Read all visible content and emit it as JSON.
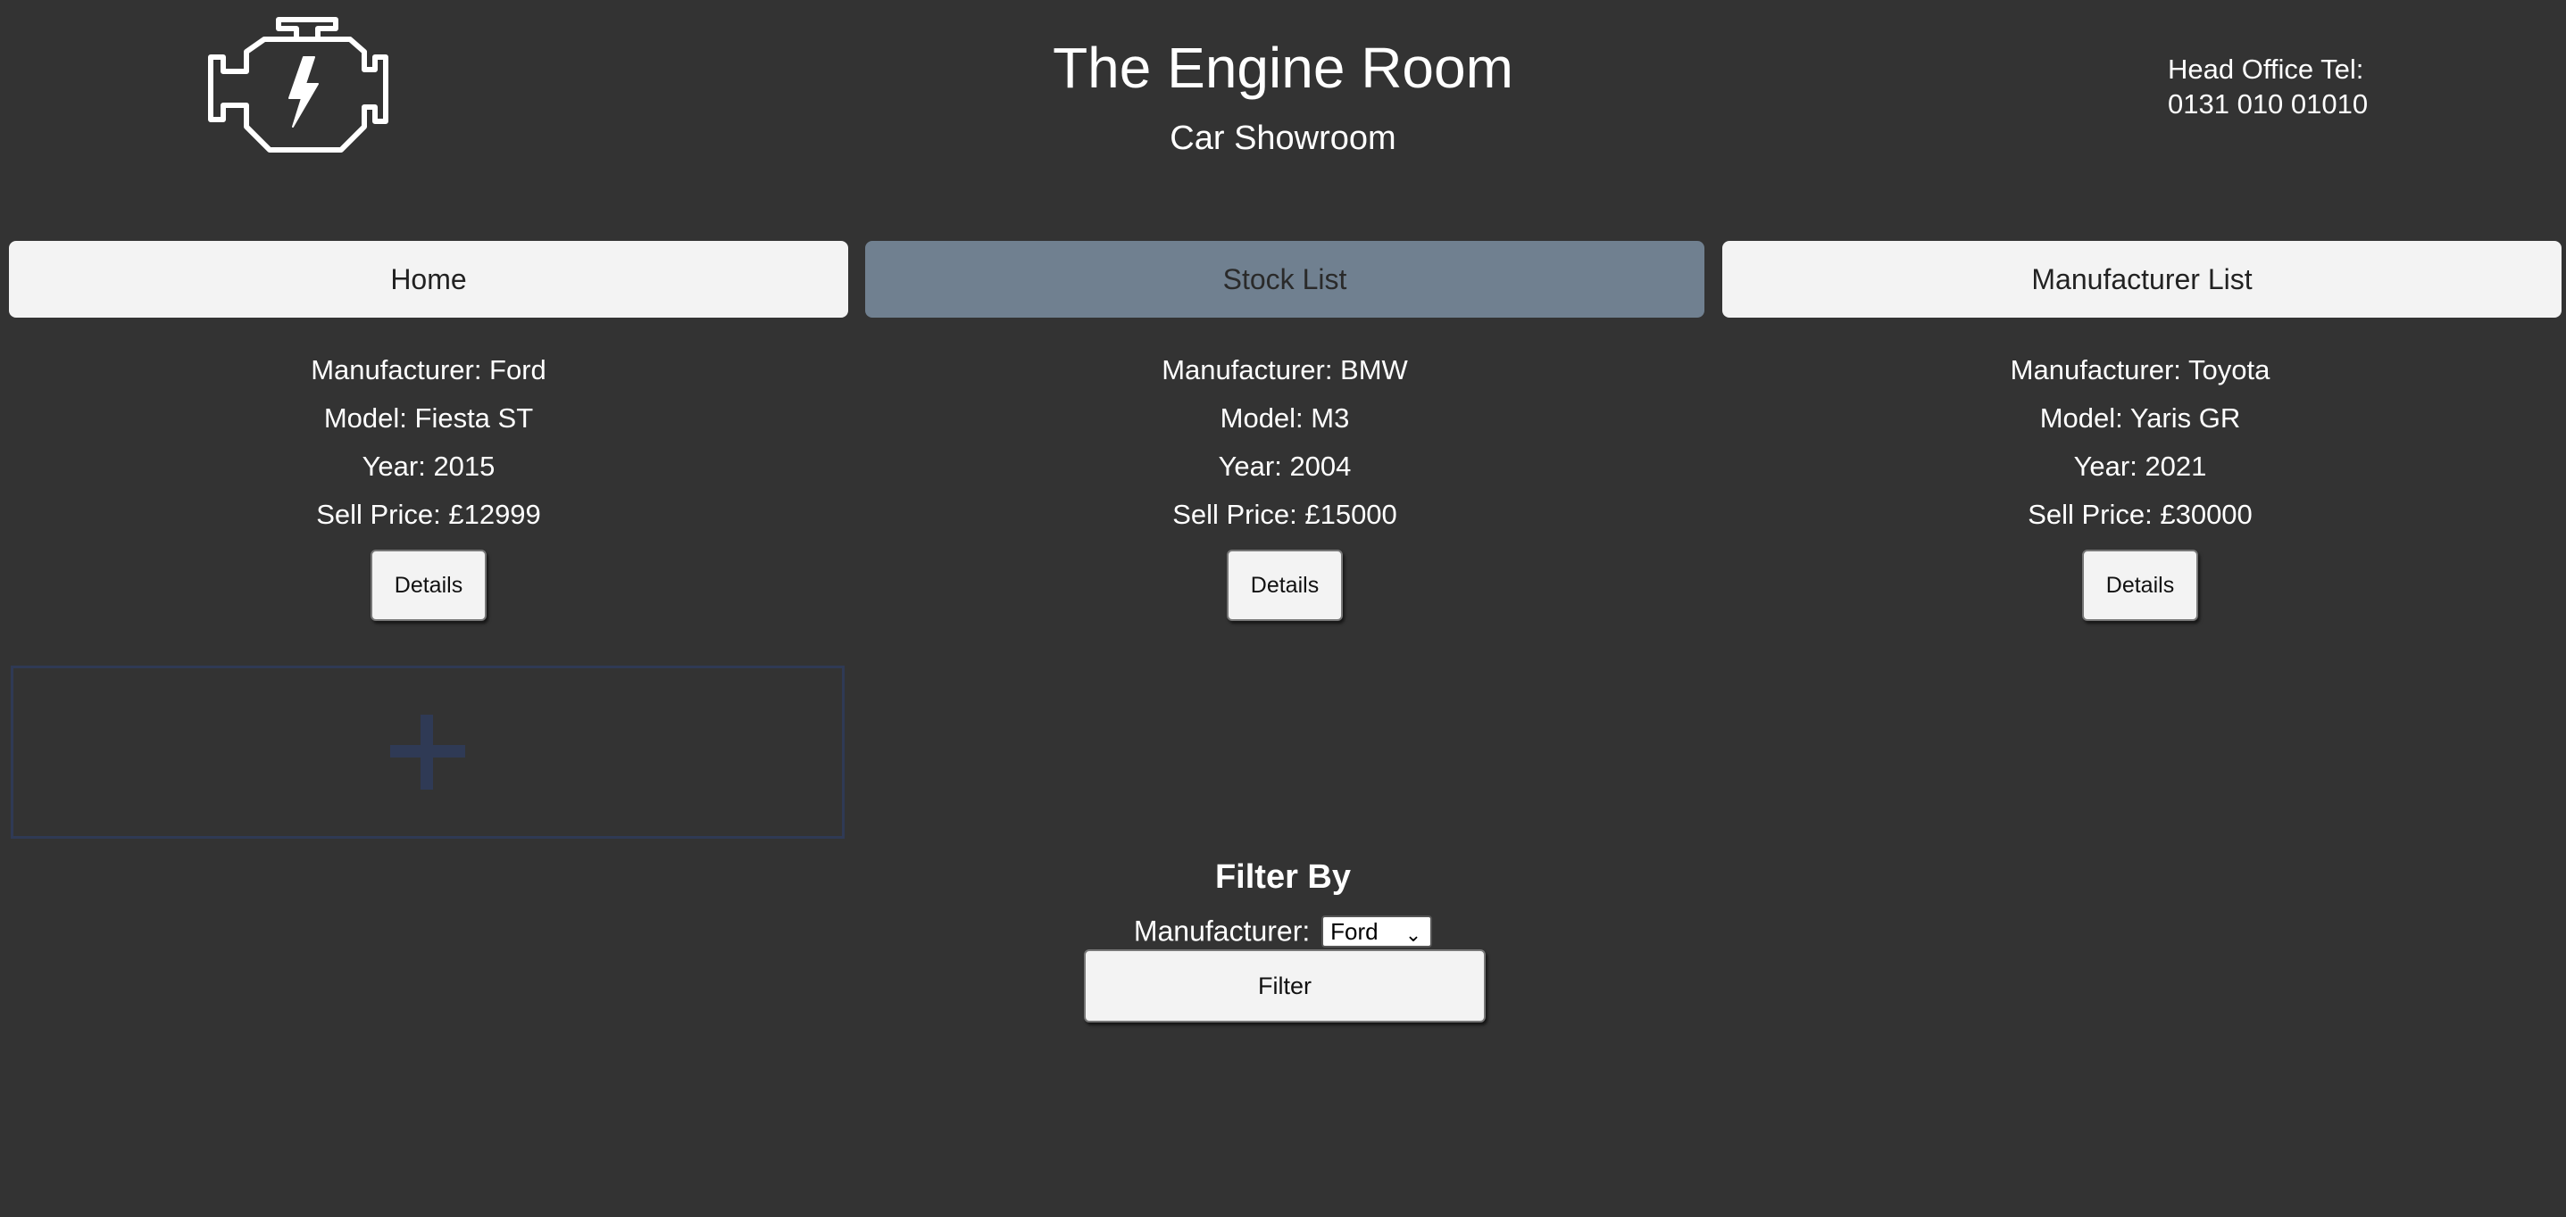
{
  "header": {
    "title": "The Engine Room",
    "subtitle": "Car Showroom",
    "office_label": "Head Office Tel:",
    "office_phone": "0131 010 01010",
    "logo_icon": "engine-icon"
  },
  "nav": {
    "items": [
      {
        "label": "Home",
        "active": false
      },
      {
        "label": "Stock List",
        "active": true
      },
      {
        "label": "Manufacturer List",
        "active": false
      }
    ],
    "active_color": "#708090"
  },
  "cars": [
    {
      "manufacturer": "Manufacturer: Ford",
      "model": "Model: Fiesta ST",
      "year": "Year: 2015",
      "price": "Sell Price: £12999",
      "button": "Details"
    },
    {
      "manufacturer": "Manufacturer: BMW",
      "model": "Model: M3",
      "year": "Year: 2004",
      "price": "Sell Price: £15000",
      "button": "Details"
    },
    {
      "manufacturer": "Manufacturer: Toyota",
      "model": "Model: Yaris GR",
      "year": "Year: 2021",
      "price": "Sell Price: £30000",
      "button": "Details"
    }
  ],
  "add": {
    "icon": "plus-icon"
  },
  "filter": {
    "title": "Filter By",
    "manufacturer_label": "Manufacturer:",
    "selected": "Ford",
    "button": "Filter"
  }
}
